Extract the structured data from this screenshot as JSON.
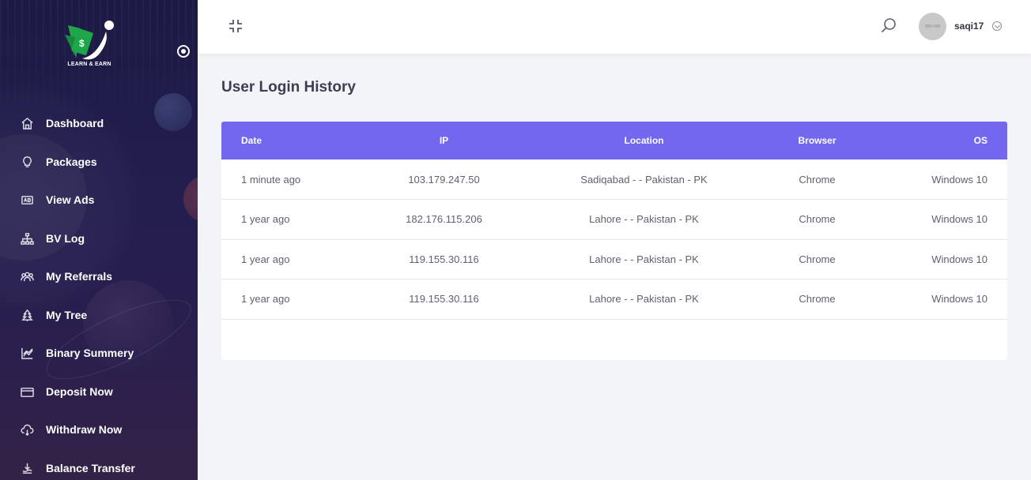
{
  "brand": {
    "logo_text": "LEARN & EARN"
  },
  "sidebar": {
    "items": [
      {
        "label": "Dashboard",
        "icon": "home-icon"
      },
      {
        "label": "Packages",
        "icon": "lightbulb-icon"
      },
      {
        "label": "View Ads",
        "icon": "ad-icon"
      },
      {
        "label": "BV Log",
        "icon": "sitemap-icon"
      },
      {
        "label": "My Referrals",
        "icon": "users-icon"
      },
      {
        "label": "My Tree",
        "icon": "tree-icon"
      },
      {
        "label": "Binary Summery",
        "icon": "chart-icon"
      },
      {
        "label": "Deposit Now",
        "icon": "credit-card-icon"
      },
      {
        "label": "Withdraw Now",
        "icon": "cloud-download-icon"
      },
      {
        "label": "Balance Transfer",
        "icon": "transfer-icon"
      }
    ]
  },
  "header": {
    "avatar_placeholder": "350×300",
    "username": "saqi17"
  },
  "page": {
    "title": "User Login History"
  },
  "table": {
    "columns": [
      "Date",
      "IP",
      "Location",
      "Browser",
      "OS"
    ],
    "rows": [
      {
        "date": "1 minute ago",
        "ip": "103.179.247.50",
        "location": "Sadiqabad - - Pakistan - PK",
        "browser": "Chrome",
        "os": "Windows 10"
      },
      {
        "date": "1 year ago",
        "ip": "182.176.115.206",
        "location": "Lahore - - Pakistan - PK",
        "browser": "Chrome",
        "os": "Windows 10"
      },
      {
        "date": "1 year ago",
        "ip": "119.155.30.116",
        "location": "Lahore - - Pakistan - PK",
        "browser": "Chrome",
        "os": "Windows 10"
      },
      {
        "date": "1 year ago",
        "ip": "119.155.30.116",
        "location": "Lahore - - Pakistan - PK",
        "browser": "Chrome",
        "os": "Windows 10"
      }
    ]
  },
  "colors": {
    "accent": "#7367f0",
    "sidebar_bg": "#1f1b48",
    "brand_green": "#1fa54a"
  }
}
